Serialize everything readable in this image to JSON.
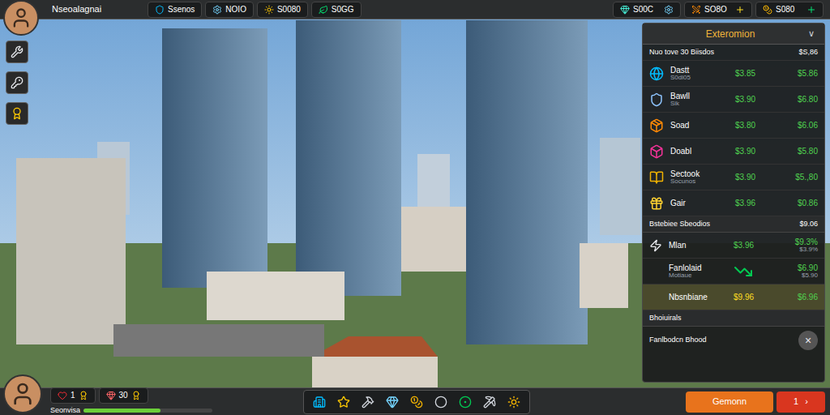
{
  "player": {
    "name": "Nseoalagnai"
  },
  "resources": [
    {
      "value": "Ssenos"
    },
    {
      "value": "NOIO"
    },
    {
      "value": "S0080"
    },
    {
      "value": "S0GG"
    }
  ],
  "right_resources": [
    {
      "value": "S00C"
    },
    {
      "value": "SO8O"
    },
    {
      "value": "S080"
    }
  ],
  "economy_panel": {
    "title": "Exteromion",
    "collapse": "∨",
    "summary": {
      "label": "Nuo tove 30 Biisdos",
      "value": "$S,86"
    },
    "items": [
      {
        "name": "Dastt",
        "sub": "S0dl05",
        "price": "$3.85",
        "value": "$5.86"
      },
      {
        "name": "Bawll",
        "sub": "Sik",
        "price": "$3.90",
        "value": "$6.80"
      },
      {
        "name": "Soad",
        "sub": "",
        "price": "$3.80",
        "value": "$6.06"
      },
      {
        "name": "Doabl",
        "sub": "",
        "price": "$3.90",
        "value": "$5.80"
      },
      {
        "name": "Sectook",
        "sub": "Socunos",
        "price": "$3.90",
        "value": "$5.,80"
      },
      {
        "name": "Gair",
        "sub": "",
        "price": "$3.96",
        "value": "$0.86"
      }
    ],
    "section": {
      "label": "Bstebiee Sbeodios",
      "value": "$9.06"
    },
    "section_items": [
      {
        "kind": "value",
        "name": "Mlan",
        "sub": "",
        "price": "$3.96",
        "value": "$9.3%",
        "value_sub": "$3.9%",
        "selected": false
      },
      {
        "kind": "trend",
        "name": "Fanlolaid",
        "sub": "Motiaue",
        "price": "",
        "value": "$6.90",
        "value_sub": "$5.90",
        "selected": false
      },
      {
        "kind": "value",
        "name": "Nbsnbiane",
        "sub": "",
        "price": "$9.96",
        "value": "$6.96",
        "value_sub": "",
        "selected": true
      }
    ],
    "section2": {
      "label": "Bhoiuirals"
    },
    "footer": {
      "label": "Fanlbodcn Bhood",
      "close": "×"
    }
  },
  "bottom_left": {
    "stats": [
      {
        "value": "1"
      },
      {
        "value": "30"
      }
    ],
    "label": "Seonvisa",
    "level": 0.6
  },
  "actions": [
    {
      "label": "Gemonn",
      "color": "#e8731c"
    },
    {
      "label": "1",
      "icon": "›",
      "color": "#d9361f"
    }
  ]
}
